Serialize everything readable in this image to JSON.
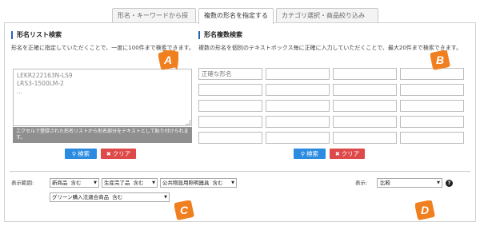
{
  "tabs": [
    {
      "label": "形名・キーワードから探す",
      "active": false
    },
    {
      "label": "複数の形名を指定する",
      "active": true
    },
    {
      "label": "カテゴリ選択・商品絞り込み",
      "active": false
    }
  ],
  "list_search": {
    "title": "形名リスト検索",
    "description": "形名を正確に指定していただくことで、一度に100件まで検索できます。",
    "lines": [
      "LEKR222163N-LS9",
      "LRS3-1500LM-2",
      "..."
    ],
    "note": "エクセルで登録された形名リストから形名部分をテキストとして貼り付けられます。",
    "search_label": "検索",
    "clear_label": "クリア"
  },
  "multi_search": {
    "title": "形名複数検索",
    "description": "複数の形名を個別のテキストボックス毎に正確に入力していただくことで、最大20件まで検索できます。",
    "placeholder": "正確な形名",
    "search_label": "検索",
    "clear_label": "クリア"
  },
  "display_range": {
    "label": "表示範囲:",
    "filters": [
      {
        "name": "新商品",
        "value": "含む"
      },
      {
        "name": "生産完了品",
        "value": "含む"
      },
      {
        "name": "公共物設用照明器具",
        "value": "含む"
      },
      {
        "name": "グリーン購入法適合商品",
        "value": "含む"
      }
    ]
  },
  "display": {
    "label": "表示:",
    "value": "比較",
    "help": "?"
  },
  "markers": [
    "A",
    "B",
    "C",
    "D"
  ],
  "colors": {
    "accent_blue": "#2b8be0",
    "clear_red": "#de4a4a",
    "marker_orange": "#f07f1f",
    "title_bar": "#2a62b8"
  }
}
